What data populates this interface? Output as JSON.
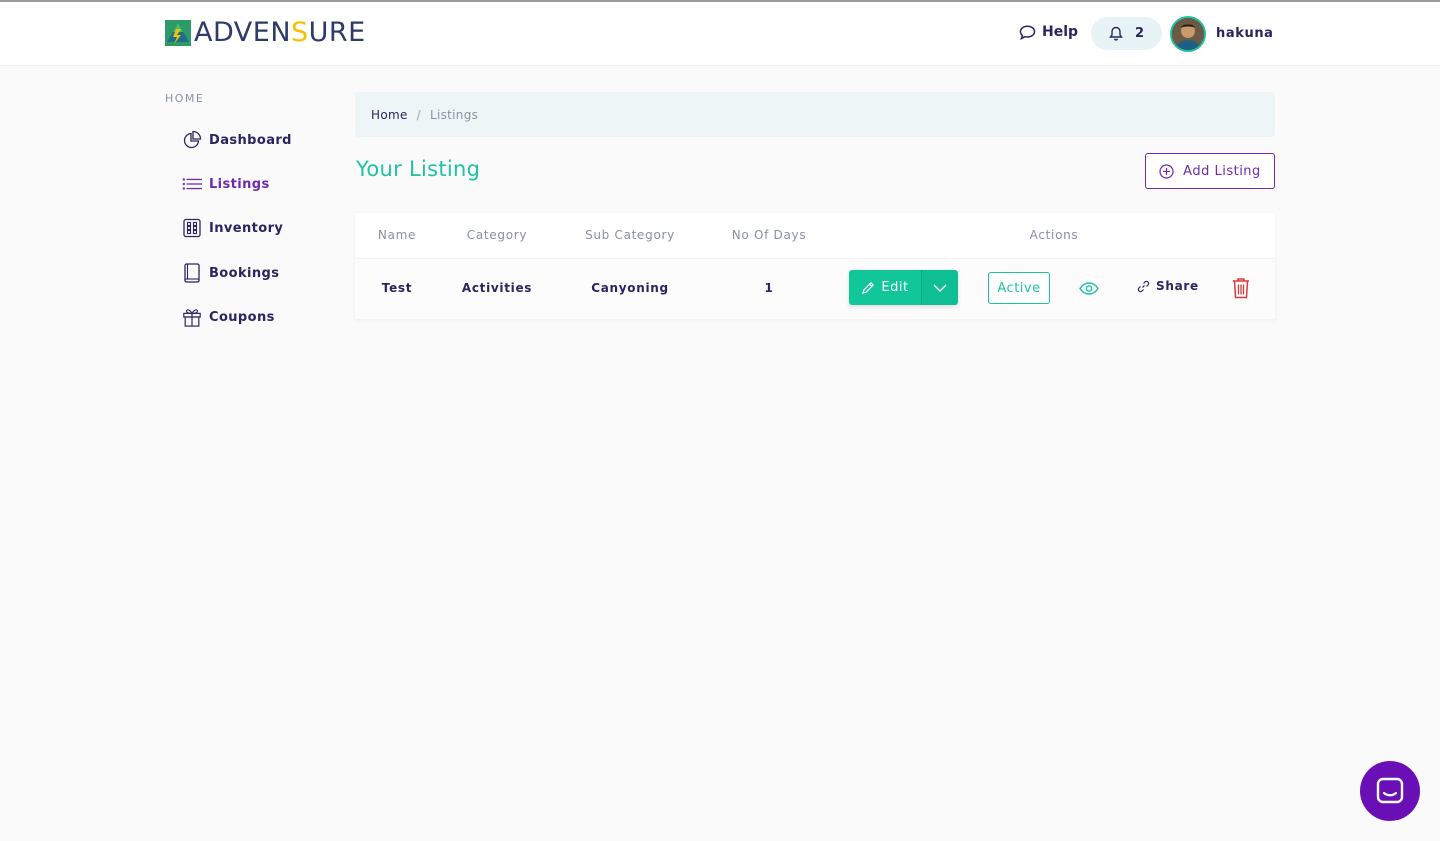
{
  "header": {
    "logo": {
      "part1": "ADVEN",
      "part2": "S",
      "part3": "URE"
    },
    "help_label": "Help",
    "notification_count": "2",
    "username": "hakuna"
  },
  "sidebar": {
    "heading": "HOME",
    "items": [
      {
        "label": "Dashboard",
        "icon": "pie-chart-icon",
        "active": false
      },
      {
        "label": "Listings",
        "icon": "list-icon",
        "active": true
      },
      {
        "label": "Inventory",
        "icon": "grid-icon",
        "active": false
      },
      {
        "label": "Bookings",
        "icon": "book-icon",
        "active": false
      },
      {
        "label": "Coupons",
        "icon": "gift-icon",
        "active": false
      }
    ]
  },
  "breadcrumb": {
    "home": "Home",
    "separator": "/",
    "current": "Listings"
  },
  "main": {
    "title": "Your Listing",
    "add_button": "Add Listing"
  },
  "table": {
    "columns": [
      "Name",
      "Category",
      "Sub Category",
      "No Of Days",
      "Actions"
    ],
    "rows": [
      {
        "name": "Test",
        "category": "Activities",
        "sub_category": "Canyoning",
        "days": "1",
        "edit_label": "Edit",
        "status_label": "Active",
        "share_label": "Share"
      }
    ]
  },
  "colors": {
    "primary_green": "#1fc3a2",
    "edit_green": "#11c79a",
    "purple": "#6c2bb0",
    "navy": "#2a2560",
    "danger": "#d63a3a",
    "logo_yellow": "#f2c200"
  }
}
